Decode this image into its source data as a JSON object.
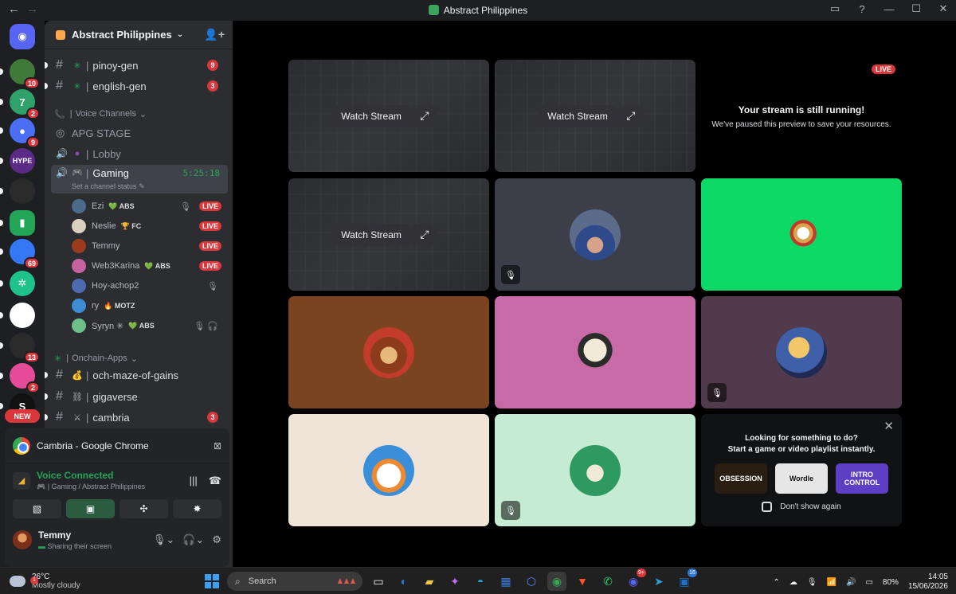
{
  "window": {
    "title": "Abstract Philippines",
    "nav_back": "←",
    "nav_forward": "→",
    "controls": [
      "▭",
      "?",
      "—",
      "☐",
      "✕"
    ]
  },
  "rail": {
    "servers": [
      {
        "name": "discord-home",
        "glyph": "◉",
        "color": "#5865f2",
        "badge": ""
      },
      {
        "name": "server-1",
        "glyph": "",
        "color": "#3f7a3a",
        "badge": "10"
      },
      {
        "name": "server-2",
        "glyph": "7",
        "color": "#2fa26b",
        "badge": "2"
      },
      {
        "name": "server-3",
        "glyph": "●",
        "color": "#4b6ef5",
        "badge": "9"
      },
      {
        "name": "server-hype",
        "glyph": "HYPE",
        "color": "#5b2a86",
        "badge": ""
      },
      {
        "name": "server-5",
        "glyph": "",
        "color": "#2a2a2a",
        "badge": ""
      },
      {
        "name": "server-6",
        "glyph": "▮",
        "color": "#23a55a",
        "badge": ""
      },
      {
        "name": "server-7",
        "glyph": "",
        "color": "#3478f6",
        "badge": "69"
      },
      {
        "name": "server-8",
        "glyph": "✲",
        "color": "#1ec28a",
        "badge": ""
      },
      {
        "name": "server-9",
        "glyph": "",
        "color": "#ffffff",
        "badge": ""
      },
      {
        "name": "server-10",
        "glyph": "",
        "color": "#2a2a2a",
        "badge": "13"
      },
      {
        "name": "server-11",
        "glyph": "",
        "color": "#e64b9a",
        "badge": "2"
      },
      {
        "name": "server-12",
        "glyph": "S",
        "color": "#111111",
        "badge": ""
      }
    ],
    "new_label": "NEW"
  },
  "server": {
    "name": "Abstract Philippines"
  },
  "channels": {
    "pinoy_gen": {
      "emoji": "✳",
      "name": "pinoy-gen",
      "count": "9"
    },
    "english_gen": {
      "emoji": "✳",
      "name": "english-gen",
      "count": "3"
    },
    "voice_category": "Voice Channels",
    "apg_stage": "APG STAGE",
    "lobby": "Lobby",
    "gaming": {
      "name": "Gaming",
      "timer": "5:25:18",
      "status": "Set a channel status"
    },
    "onchain_category": "Onchain-Apps",
    "och_maze": "och-maze-of-gains",
    "gigaverse": "gigaverse",
    "cambria": {
      "name": "cambria",
      "count": "3"
    }
  },
  "voice_users": [
    {
      "name": "Ezi",
      "tag": "💚 ABS",
      "live": "LIVE",
      "icon": "🎙",
      "color": "#4a6b8a"
    },
    {
      "name": "Neslie",
      "tag": "🏆 FC",
      "live": "LIVE",
      "icon": "",
      "color": "#d9d2c0"
    },
    {
      "name": "Temmy",
      "tag": "",
      "live": "LIVE",
      "icon": "",
      "color": "#9a3b1c"
    },
    {
      "name": "Web3Karina",
      "tag": "💚 ABS",
      "live": "LIVE",
      "icon": "",
      "color": "#c4639e"
    },
    {
      "name": "Hoy-achop2",
      "tag": "",
      "live": "",
      "icon": "🎙",
      "color": "#4f6bb0"
    },
    {
      "name": "ry",
      "tag": "🔥 MOTZ",
      "live": "",
      "icon": "",
      "color": "#3d8dd6"
    },
    {
      "name": "Syryn ✳",
      "tag": "💚 ABS",
      "live": "",
      "icon": "🎙 🎧",
      "color": "#6dbf8a"
    }
  ],
  "share": {
    "app": "Cambria - Google Chrome",
    "stop_icon": "⊠"
  },
  "voice_connection": {
    "status": "Voice Connected",
    "location": "🎮 | Gaming / Abstract Philippines",
    "buttons": [
      "▧",
      "▣",
      "✣",
      "✸"
    ]
  },
  "me": {
    "name": "Temmy",
    "status": "Sharing their screen"
  },
  "stage": {
    "watch_label": "Watch Stream",
    "pop_icon": "⤢",
    "live_label": "LIVE",
    "notice_title": "Your stream is still running!",
    "notice_sub": "We've paused this preview to save your resources.",
    "suggest_title_1": "Looking for something to do?",
    "suggest_title_2": "Start a game or video playlist instantly.",
    "games": [
      {
        "name": "OBSESSION",
        "bg": "#2a1d12",
        "fg": "#ffffff"
      },
      {
        "name": "Wordle",
        "bg": "#e6e6e6",
        "fg": "#111111"
      },
      {
        "name": "INTRO CONTROL",
        "bg": "#5c3fc4",
        "fg": "#ffffff"
      }
    ],
    "dont_show": "Don't show again",
    "mute_icon": "🎙",
    "close_icon": "✕"
  },
  "taskbar": {
    "temp": "26°C",
    "weather": "Mostly cloudy",
    "weather_badge": "1",
    "search": "Search",
    "apps": [
      {
        "name": "task-view",
        "glyph": "▭",
        "color": "#ffffff",
        "badge": ""
      },
      {
        "name": "edge-beta",
        "glyph": "◐",
        "color": "#2a7bd6",
        "badge": ""
      },
      {
        "name": "file-explorer",
        "glyph": "▰",
        "color": "#f2c744",
        "badge": ""
      },
      {
        "name": "copilot",
        "glyph": "✦",
        "color": "#c46bf0",
        "badge": ""
      },
      {
        "name": "edge",
        "glyph": "◓",
        "color": "#1fa3c9",
        "badge": ""
      },
      {
        "name": "store",
        "glyph": "▦",
        "color": "#3a7be0",
        "badge": ""
      },
      {
        "name": "box-app",
        "glyph": "⬡",
        "color": "#4f8df5",
        "badge": ""
      },
      {
        "name": "chrome",
        "glyph": "◉",
        "color": "#34a853",
        "badge": ""
      },
      {
        "name": "brave",
        "glyph": "▼",
        "color": "#fb542b",
        "badge": ""
      },
      {
        "name": "whatsapp",
        "glyph": "✆",
        "color": "#25d366",
        "badge": ""
      },
      {
        "name": "discord",
        "glyph": "◉",
        "color": "#5865f2",
        "badge": "9+"
      },
      {
        "name": "telegram",
        "glyph": "➤",
        "color": "#2aa1da",
        "badge": ""
      },
      {
        "name": "outlook",
        "glyph": "▣",
        "color": "#1a73c8",
        "badge": "16"
      }
    ],
    "battery": "80%",
    "time": "14:05",
    "date": "15/06/2026"
  }
}
